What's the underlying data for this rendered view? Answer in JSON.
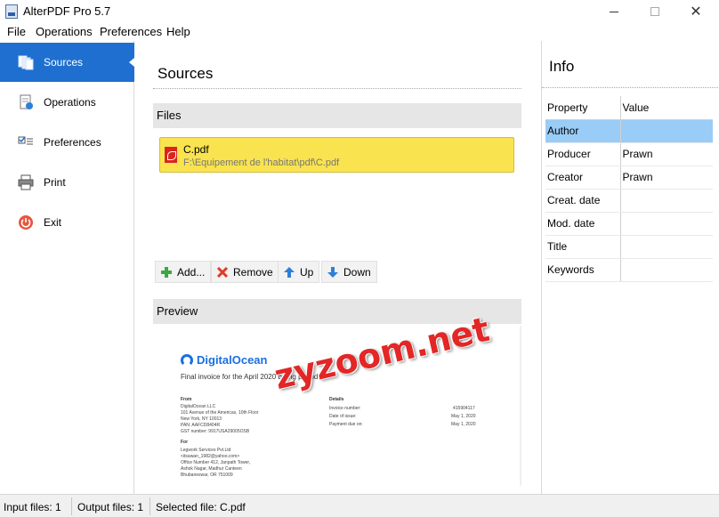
{
  "window": {
    "title": "AlterPDF Pro 5.7"
  },
  "menu": [
    "File",
    "Operations",
    "Preferences",
    "Help"
  ],
  "sidebar": {
    "items": [
      {
        "label": "Sources",
        "icon": "sources-icon",
        "active": true
      },
      {
        "label": "Operations",
        "icon": "operations-icon",
        "active": false
      },
      {
        "label": "Preferences",
        "icon": "preferences-icon",
        "active": false
      },
      {
        "label": "Print",
        "icon": "printer-icon",
        "active": false
      },
      {
        "label": "Exit",
        "icon": "power-icon",
        "active": false
      }
    ]
  },
  "sources": {
    "title": "Sources",
    "files_header": "Files",
    "files": [
      {
        "name": "C.pdf",
        "path": "F:\\Equipement de l'habitat\\pdf\\C.pdf",
        "selected": true
      }
    ],
    "buttons": {
      "add": "Add...",
      "remove": "Remove",
      "up": "Up",
      "down": "Down"
    },
    "preview_header": "Preview"
  },
  "preview_doc": {
    "logo": "DigitalOcean",
    "subtitle": "Final invoice for the April 2020 billing period",
    "from_label": "From",
    "from_lines": [
      "DigitalOcean LLC",
      "101 Avenue of the Americas, 10th Floor",
      "New York, NY 10013",
      "PAN: AAFCD8404R",
      "GST number: 9917USA29005OSB"
    ],
    "details_label": "Details",
    "details_rows": [
      {
        "key": "Invoice number:",
        "value": "415904117"
      },
      {
        "key": "Date of issue:",
        "value": "May 1, 2020"
      },
      {
        "key": "Payment due on:",
        "value": "May 1, 2020"
      }
    ],
    "for_label": "For",
    "for_lines": [
      "Legwork Services Pvt.Ltd",
      "<itsawan_1982@yahoo.com>",
      "Office Number 412, Janpath Tower,",
      "Ashok Nagar, Madhur Canteen",
      "Bhubaneswar, OR 751009"
    ]
  },
  "watermark": "zyzoom.net",
  "info": {
    "title": "Info",
    "columns": [
      "Property",
      "Value"
    ],
    "rows": [
      {
        "property": "Author",
        "value": "",
        "selected": true
      },
      {
        "property": "Producer",
        "value": "Prawn",
        "selected": false
      },
      {
        "property": "Creator",
        "value": "Prawn",
        "selected": false
      },
      {
        "property": "Creat. date",
        "value": "",
        "selected": false
      },
      {
        "property": "Mod. date",
        "value": "",
        "selected": false
      },
      {
        "property": "Title",
        "value": "",
        "selected": false
      },
      {
        "property": "Keywords",
        "value": "",
        "selected": false
      }
    ]
  },
  "status": {
    "input_files": "Input files: 1",
    "output_files": "Output files: 1",
    "selected_file": "Selected file: C.pdf"
  },
  "colors": {
    "accent": "#1f6fd0",
    "file_highlight": "#f9e34f",
    "row_selected": "#99ccf7"
  }
}
